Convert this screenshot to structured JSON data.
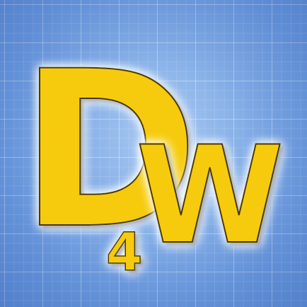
{
  "logo": {
    "letter_main": "D",
    "letter_sub": "4",
    "letter_second": "W"
  },
  "colors": {
    "letter_fill": "#f6cb07",
    "letter_stroke": "#3a3000",
    "glow": "#ffffff",
    "background": "#88b1e8"
  }
}
